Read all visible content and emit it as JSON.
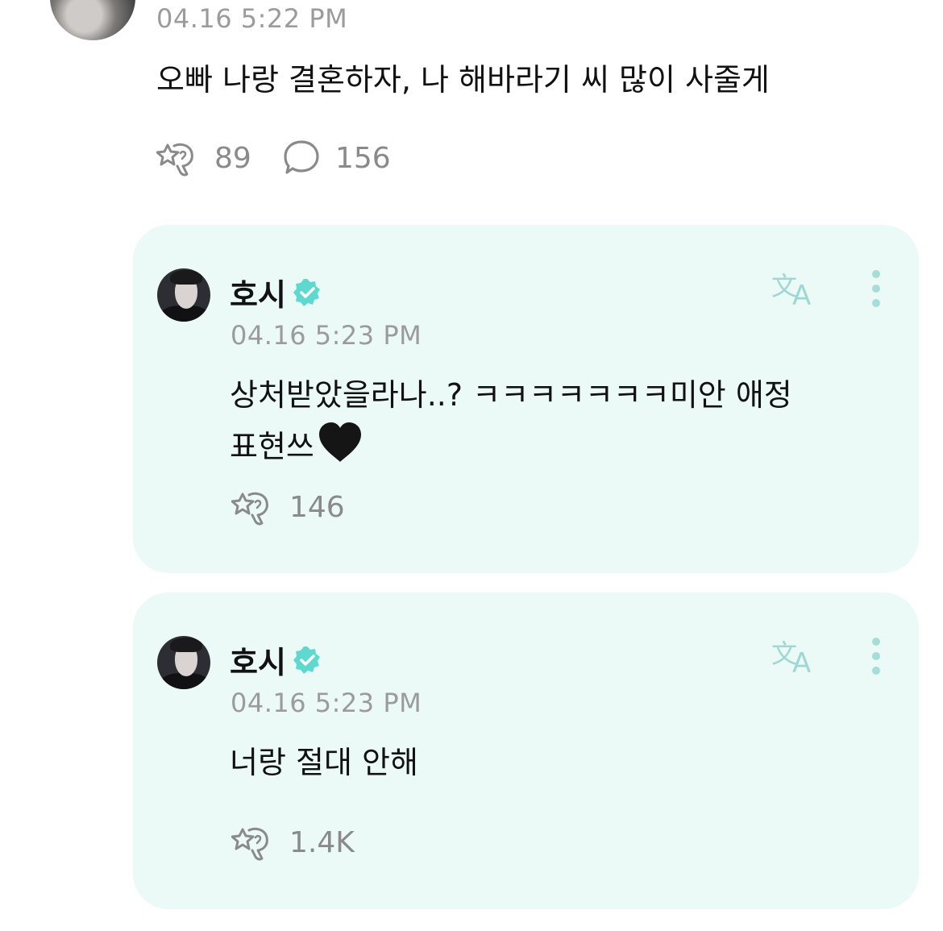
{
  "post": {
    "timestamp": "04.16 5:22 PM",
    "text": "오빠 나랑 결혼하자, 나 해바라기 씨 많이 사줄게",
    "reactions_count": "89",
    "comments_count": "156"
  },
  "replies": [
    {
      "author": "호시",
      "verified": true,
      "timestamp": "04.16 5:23 PM",
      "text_line1": "상처받았을라나..? ㅋㅋㅋㅋㅋㅋㅋ미안 애정",
      "text_line2": "표현쓰",
      "emoji": "black-heart",
      "reactions_count": "146"
    },
    {
      "author": "호시",
      "verified": true,
      "timestamp": "04.16 5:23 PM",
      "text": "너랑 절대 안해",
      "reactions_count": "1.4K"
    }
  ],
  "icons": {
    "reaction": "weverse-reaction-icon",
    "comment": "speech-bubble-icon",
    "translate": "translate-icon",
    "more": "vertical-dots-icon",
    "verified": "verified-badge-icon"
  },
  "colors": {
    "card_background": "#ebfaf7",
    "accent": "#5fd9d0",
    "timestamp": "#9b9b9b"
  }
}
